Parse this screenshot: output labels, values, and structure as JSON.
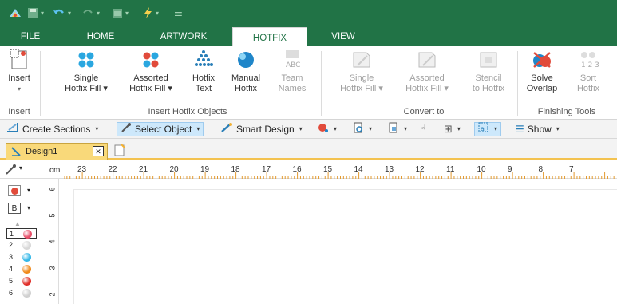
{
  "quick_access": {
    "icons": [
      "app-logo-icon",
      "save-icon",
      "undo-icon",
      "redo-icon",
      "calendar-icon",
      "lightning-icon",
      "customize-icon"
    ]
  },
  "tabs": [
    {
      "label": "FILE"
    },
    {
      "label": "HOME"
    },
    {
      "label": "ARTWORK"
    },
    {
      "label": "HOTFIX",
      "active": true
    },
    {
      "label": "VIEW"
    }
  ],
  "ribbon": {
    "insert": {
      "line1": "Insert",
      "line2": "▾"
    },
    "single_hotfix_fill": {
      "line1": "Single",
      "line2": "Hotfix Fill ▾"
    },
    "assorted_hotfix_fill": {
      "line1": "Assorted",
      "line2": "Hotfix Fill ▾"
    },
    "hotfix_text": {
      "line1": "Hotfix",
      "line2": "Text"
    },
    "manual_hotfix": {
      "line1": "Manual",
      "line2": "Hotfix"
    },
    "team_names": {
      "line1": "Team",
      "line2": "Names"
    },
    "conv_single": {
      "line1": "Single",
      "line2": "Hotfix Fill ▾"
    },
    "conv_assorted": {
      "line1": "Assorted",
      "line2": "Hotfix Fill ▾"
    },
    "stencil": {
      "line1": "Stencil",
      "line2": "to Hotfix"
    },
    "solve_overlap": {
      "line1": "Solve",
      "line2": "Overlap"
    },
    "sort_hotfix": {
      "line1": "Sort",
      "line2": "Hotfix"
    },
    "groups": {
      "insert": "Insert",
      "insert_hotfix_objects": "Insert Hotfix Objects",
      "convert_to": "Convert to",
      "finishing_tools": "Finishing Tools"
    }
  },
  "toolbar": {
    "create_sections": "Create Sections",
    "select_object": "Select Object",
    "smart_design": "Smart Design",
    "show": "Show"
  },
  "doc_tab": {
    "label": "Design1",
    "close": "✕"
  },
  "ruler": {
    "unit": "cm",
    "labels": [
      "23",
      "22",
      "21",
      "20",
      "19",
      "18",
      "17",
      "16",
      "15",
      "14",
      "13",
      "12",
      "11",
      "10",
      "9",
      "8",
      "7"
    ],
    "vlabels": [
      "6",
      "5",
      "4",
      "3",
      "2"
    ]
  },
  "left_panel": {
    "letter": "B",
    "layers": [
      {
        "n": "1",
        "color": "#e8506a"
      },
      {
        "n": "2",
        "color": "#d8d8d8"
      },
      {
        "n": "3",
        "color": "#35b8e8"
      },
      {
        "n": "4",
        "color": "#f08a1c"
      },
      {
        "n": "5",
        "color": "#e0302a"
      },
      {
        "n": "6",
        "color": "#d0d0d0"
      }
    ]
  },
  "colors": {
    "brand": "#217346",
    "doc_tab": "#f9d97a",
    "selected": "#cde8fb"
  }
}
